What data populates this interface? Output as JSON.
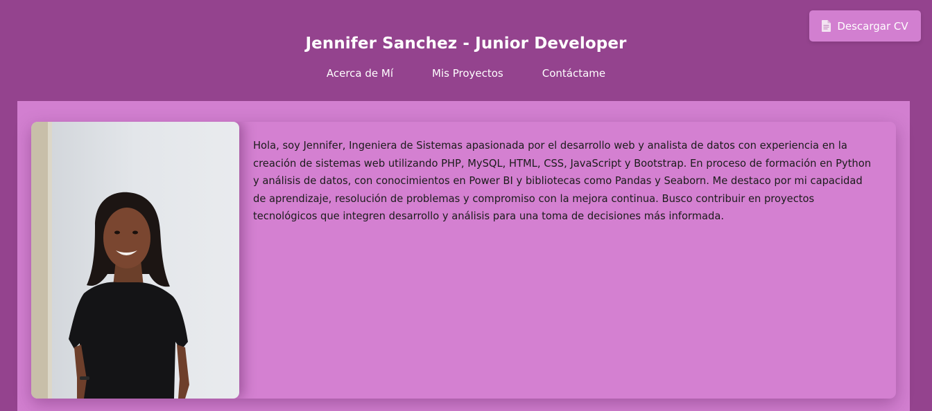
{
  "header": {
    "title": "Jennifer Sanchez - Junior Developer",
    "nav": [
      {
        "label": "Acerca de Mí"
      },
      {
        "label": "Mis Proyectos"
      },
      {
        "label": "Contáctame"
      }
    ],
    "cv_button": {
      "label": "Descargar CV",
      "icon": "document-icon"
    }
  },
  "about": {
    "photo_alt": "Foto de perfil",
    "text": "Hola, soy Jennifer, Ingeniera de Sistemas apasionada por el desarrollo web y analista de datos con experiencia en la creación de sistemas web utilizando PHP, MySQL, HTML, CSS, JavaScript y Bootstrap. En proceso de formación en Python y análisis de datos, con conocimientos en Power BI y bibliotecas como Pandas y Seaborn. Me destaco por mi capacidad de aprendizaje, resolución de problemas y compromiso con la mejora continua. Busco contribuir en proyectos tecnológicos que integren desarrollo y análisis para una toma de decisiones más informada."
  },
  "colors": {
    "page_background": "#94438e",
    "section_background": "#d27fd0",
    "button_background": "#d27fd0",
    "header_text": "#ffffff",
    "body_text": "#1b1b1b"
  }
}
